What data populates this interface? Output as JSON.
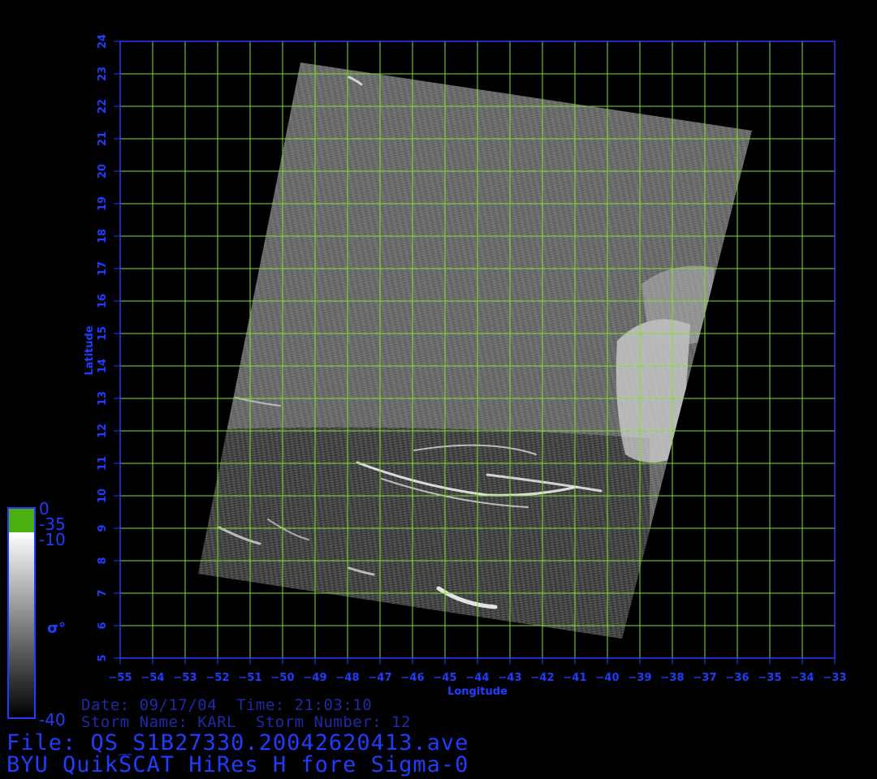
{
  "map": {
    "lon_range": [
      -55,
      -33
    ],
    "lat_range": [
      5,
      24
    ],
    "lon_ticks": [
      -55,
      -54,
      -53,
      -52,
      -51,
      -50,
      -49,
      -48,
      -47,
      -46,
      -45,
      -44,
      -43,
      -42,
      -41,
      -40,
      -39,
      -38,
      -37,
      -36,
      -35,
      -34,
      -33
    ],
    "lat_ticks": [
      5,
      6,
      7,
      8,
      9,
      10,
      11,
      12,
      13,
      14,
      15,
      16,
      17,
      18,
      19,
      20,
      21,
      22,
      23,
      24
    ],
    "xlabel": "Longitude",
    "ylabel": "Latitude",
    "grid": true,
    "swath_corners": [
      {
        "lon": -49.45,
        "lat": 23.35
      },
      {
        "lon": -35.55,
        "lat": 21.25
      },
      {
        "lon": -39.55,
        "lat": 5.6
      },
      {
        "lon": -52.6,
        "lat": 7.6
      }
    ],
    "colors": {
      "background": "#000000",
      "axis": "#1f3dff",
      "grid": "#7fe030",
      "swath": "#6e6e6e"
    }
  },
  "colorbar": {
    "top_label": "0",
    "green_label": "-35",
    "white_label": "-10",
    "bottom_label": "-40",
    "symbol": "σ°",
    "colors": {
      "green": "#4ab010",
      "white": "#ffffff",
      "black": "#000000"
    }
  },
  "info": {
    "date_line": "Date: 09/17/04  Time: 21:03:10",
    "storm_line": "Storm Name: KARL  Storm Number: 12",
    "file_line": "File: QS_S1B27330.20042620413.ave",
    "product_line": "BYU QuikSCAT HiRes H fore Sigma-0"
  }
}
